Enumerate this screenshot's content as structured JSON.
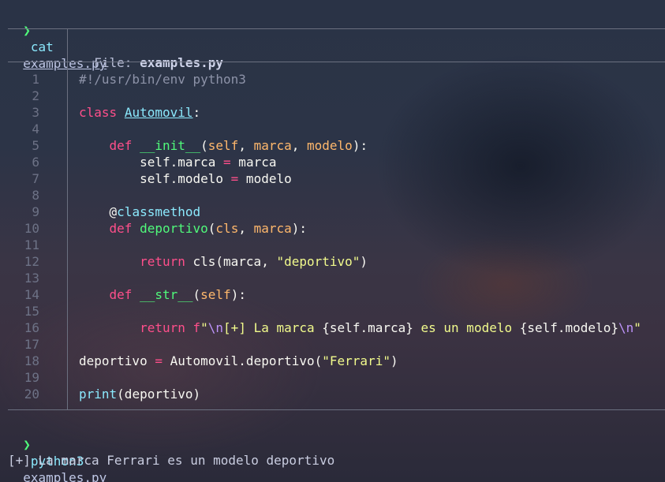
{
  "prompt_symbol": "❯",
  "command1": {
    "cmd": "cat",
    "arg": "examples.py"
  },
  "file_header": {
    "label": "File: ",
    "filename": "examples.py"
  },
  "code_lines": [
    {
      "n": "1",
      "tokens": [
        {
          "t": "#!/usr/bin/env python3",
          "c": "comment"
        }
      ]
    },
    {
      "n": "2",
      "tokens": []
    },
    {
      "n": "3",
      "tokens": [
        {
          "t": "class",
          "c": "keyword"
        },
        {
          "t": " ",
          "c": "plain"
        },
        {
          "t": "Automovil",
          "c": "class"
        },
        {
          "t": ":",
          "c": "plain"
        }
      ]
    },
    {
      "n": "4",
      "tokens": []
    },
    {
      "n": "5",
      "tokens": [
        {
          "t": "    ",
          "c": "plain"
        },
        {
          "t": "def",
          "c": "def"
        },
        {
          "t": " ",
          "c": "plain"
        },
        {
          "t": "__init__",
          "c": "func"
        },
        {
          "t": "(",
          "c": "plain"
        },
        {
          "t": "self",
          "c": "param"
        },
        {
          "t": ", ",
          "c": "plain"
        },
        {
          "t": "marca",
          "c": "param"
        },
        {
          "t": ", ",
          "c": "plain"
        },
        {
          "t": "modelo",
          "c": "param"
        },
        {
          "t": "):",
          "c": "plain"
        }
      ]
    },
    {
      "n": "6",
      "tokens": [
        {
          "t": "        self.marca ",
          "c": "plain"
        },
        {
          "t": "=",
          "c": "op"
        },
        {
          "t": " marca",
          "c": "plain"
        }
      ]
    },
    {
      "n": "7",
      "tokens": [
        {
          "t": "        self.modelo ",
          "c": "plain"
        },
        {
          "t": "=",
          "c": "op"
        },
        {
          "t": " modelo",
          "c": "plain"
        }
      ]
    },
    {
      "n": "8",
      "tokens": []
    },
    {
      "n": "9",
      "tokens": [
        {
          "t": "    @",
          "c": "plain"
        },
        {
          "t": "classmethod",
          "c": "decorator"
        }
      ]
    },
    {
      "n": "10",
      "tokens": [
        {
          "t": "    ",
          "c": "plain"
        },
        {
          "t": "def",
          "c": "def"
        },
        {
          "t": " ",
          "c": "plain"
        },
        {
          "t": "deportivo",
          "c": "func"
        },
        {
          "t": "(",
          "c": "plain"
        },
        {
          "t": "cls",
          "c": "param"
        },
        {
          "t": ", ",
          "c": "plain"
        },
        {
          "t": "marca",
          "c": "param"
        },
        {
          "t": "):",
          "c": "plain"
        }
      ]
    },
    {
      "n": "11",
      "tokens": []
    },
    {
      "n": "12",
      "tokens": [
        {
          "t": "        ",
          "c": "plain"
        },
        {
          "t": "return",
          "c": "keyword"
        },
        {
          "t": " cls(marca, ",
          "c": "plain"
        },
        {
          "t": "\"deportivo\"",
          "c": "string"
        },
        {
          "t": ")",
          "c": "plain"
        }
      ]
    },
    {
      "n": "13",
      "tokens": []
    },
    {
      "n": "14",
      "tokens": [
        {
          "t": "    ",
          "c": "plain"
        },
        {
          "t": "def",
          "c": "def"
        },
        {
          "t": " ",
          "c": "plain"
        },
        {
          "t": "__str__",
          "c": "func"
        },
        {
          "t": "(",
          "c": "plain"
        },
        {
          "t": "self",
          "c": "param"
        },
        {
          "t": "):",
          "c": "plain"
        }
      ]
    },
    {
      "n": "15",
      "tokens": []
    },
    {
      "n": "16",
      "tokens": [
        {
          "t": "        ",
          "c": "plain"
        },
        {
          "t": "return",
          "c": "keyword"
        },
        {
          "t": " ",
          "c": "plain"
        },
        {
          "t": "f",
          "c": "fprefix"
        },
        {
          "t": "\"",
          "c": "string"
        },
        {
          "t": "\\n",
          "c": "escape"
        },
        {
          "t": "[+] La marca ",
          "c": "string"
        },
        {
          "t": "{self.marca}",
          "c": "bracket"
        },
        {
          "t": " es un modelo ",
          "c": "string"
        },
        {
          "t": "{self.modelo}",
          "c": "bracket"
        },
        {
          "t": "\\n",
          "c": "escape"
        },
        {
          "t": "\"",
          "c": "string"
        }
      ]
    },
    {
      "n": "17",
      "tokens": []
    },
    {
      "n": "18",
      "tokens": [
        {
          "t": "deportivo ",
          "c": "plain"
        },
        {
          "t": "=",
          "c": "op"
        },
        {
          "t": " Automovil.deportivo(",
          "c": "plain"
        },
        {
          "t": "\"Ferrari\"",
          "c": "string"
        },
        {
          "t": ")",
          "c": "plain"
        }
      ]
    },
    {
      "n": "19",
      "tokens": []
    },
    {
      "n": "20",
      "tokens": [
        {
          "t": "print",
          "c": "builtin"
        },
        {
          "t": "(deportivo)",
          "c": "plain"
        }
      ]
    }
  ],
  "command2": {
    "cmd": "python3",
    "arg": "examples.py"
  },
  "output_line": "[+] La marca Ferrari es un modelo deportivo",
  "colors": {
    "prompt": "#50fa7b",
    "command": "#8be9fd",
    "keyword": "#ff4f8b",
    "function": "#50fa7b",
    "parameter": "#ffb86c",
    "string": "#f1fa8c",
    "comment": "#8d93a8",
    "escape": "#bd93f9"
  }
}
